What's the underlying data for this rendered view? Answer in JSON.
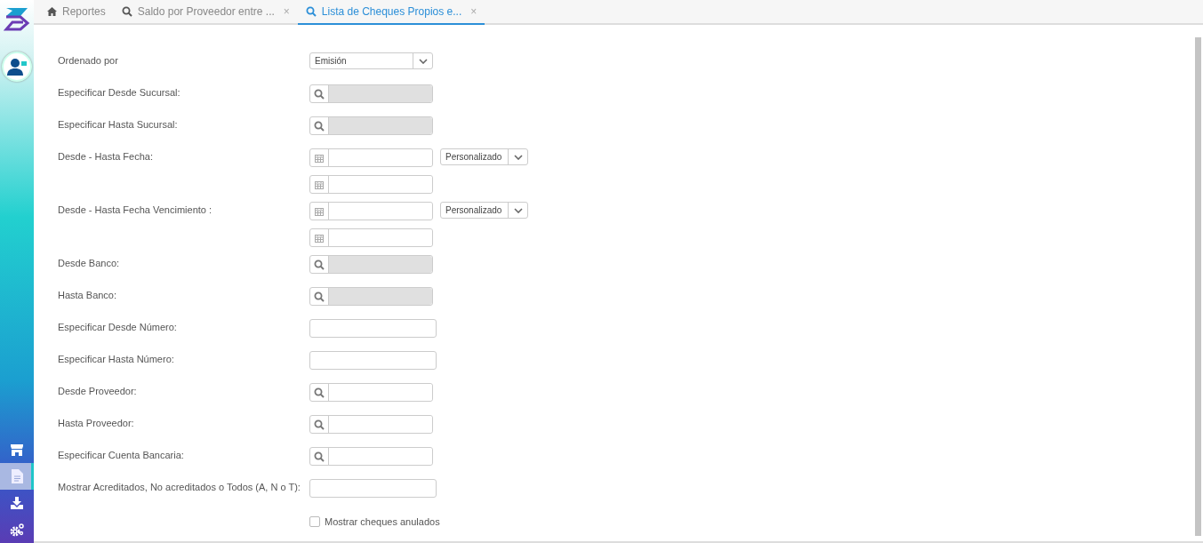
{
  "tabs": [
    {
      "label": "Reportes",
      "kind": "home",
      "selected": false
    },
    {
      "label": "Saldo por Proveedor entre ...",
      "kind": "search",
      "close": "×",
      "selected": false
    },
    {
      "label": "Lista de Cheques Propios e...",
      "kind": "search",
      "close": "×",
      "selected": true
    }
  ],
  "sidebar": {
    "items": [
      {
        "selected": false
      },
      {
        "selected": true
      },
      {
        "selected": false
      },
      {
        "selected": false
      }
    ]
  },
  "form": {
    "rows": [
      {
        "kind": "select",
        "label": "Ordenado por",
        "value": "Emisión"
      },
      {
        "kind": "lookup",
        "label": "Especificar Desde Sucursal:",
        "disabled": true
      },
      {
        "kind": "lookup",
        "label": "Especificar Hasta Sucursal:",
        "disabled": true
      },
      {
        "kind": "daterange",
        "label": "Desde - Hasta Fecha:",
        "preset": "Personalizado"
      },
      {
        "kind": "daterange",
        "label": "Desde - Hasta Fecha Vencimiento :",
        "preset": "Personalizado"
      },
      {
        "kind": "lookup",
        "label": "Desde Banco:",
        "disabled": true
      },
      {
        "kind": "lookup",
        "label": "Hasta Banco:",
        "disabled": true
      },
      {
        "kind": "text",
        "label": "Especificar Desde Número:"
      },
      {
        "kind": "text",
        "label": "Especificar Hasta Número:"
      },
      {
        "kind": "lookup",
        "label": "Desde Proveedor:",
        "disabled": false
      },
      {
        "kind": "lookup",
        "label": "Hasta Proveedor:",
        "disabled": false
      },
      {
        "kind": "lookup",
        "label": "Especificar Cuenta Bancaria:",
        "disabled": false
      },
      {
        "kind": "text",
        "label": "Mostrar Acreditados, No acreditados o Todos (A, N o T):"
      },
      {
        "kind": "checkbox",
        "label": "Mostrar cheques anulados",
        "checked": false
      }
    ]
  }
}
